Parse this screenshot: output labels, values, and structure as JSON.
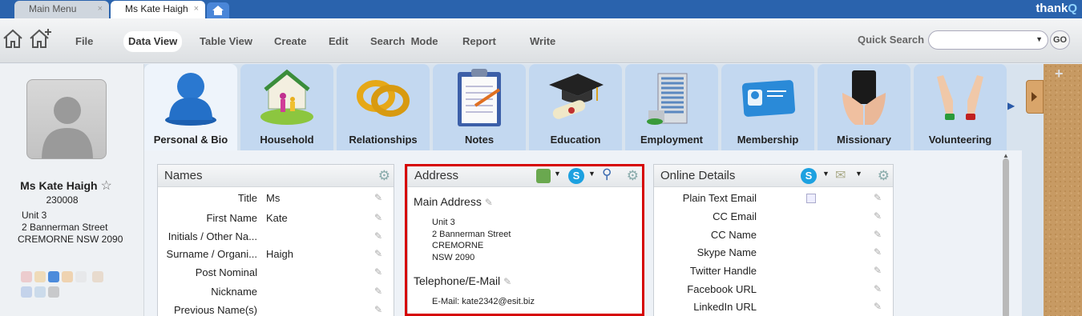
{
  "tabs": [
    {
      "label": "Main Menu",
      "close": "×"
    },
    {
      "label": "Ms Kate Haigh",
      "close": "×"
    }
  ],
  "brand": {
    "text": "thank",
    "accent": "Q"
  },
  "menu": [
    "File",
    "Data View",
    "Table View",
    "Create",
    "Edit",
    "Search  Mode",
    "Report",
    "Write"
  ],
  "quick_search": {
    "label": "Quick Search",
    "value": "",
    "go": "GO"
  },
  "profile": {
    "name": "Ms Kate Haigh",
    "star": "☆",
    "id": "230008",
    "address": [
      "Unit 3",
      "2 Bannerman Street",
      "CREMORNE NSW 2090"
    ]
  },
  "categories": [
    "Personal & Bio",
    "Household",
    "Relationships",
    "Notes",
    "Education",
    "Employment",
    "Membership",
    "Missionary",
    "Volunteering"
  ],
  "names_card": {
    "title": "Names",
    "rows": [
      {
        "label": "Title",
        "value": "Ms"
      },
      {
        "label": "First Name",
        "value": "Kate"
      },
      {
        "label": "Initials / Other Na...",
        "value": ""
      },
      {
        "label": "Surname / Organi...",
        "value": "Haigh"
      },
      {
        "label": "Post Nominal",
        "value": ""
      },
      {
        "label": "Nickname",
        "value": ""
      },
      {
        "label": "Previous Name(s)",
        "value": ""
      }
    ]
  },
  "address_card": {
    "title": "Address",
    "main_label": "Main Address",
    "main_lines": [
      "Unit 3",
      "2 Bannerman Street",
      "CREMORNE",
      "NSW 2090"
    ],
    "tel_label": "Telephone/E-Mail",
    "email_line": "E-Mail: kate2342@esit.biz"
  },
  "online_card": {
    "title": "Online Details",
    "rows": [
      "Plain Text Email",
      "CC Email",
      "CC Name",
      "Skype Name",
      "Twitter Handle",
      "Facebook URL",
      "LinkedIn URL"
    ]
  },
  "colors": {
    "accent": "#2a63ad",
    "highlight": "#d60000",
    "cork": "#c79a63"
  }
}
